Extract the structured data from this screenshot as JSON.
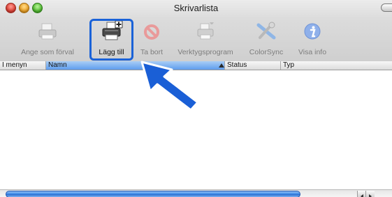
{
  "window": {
    "title": "Skrivarlista"
  },
  "toolbar": {
    "items": [
      {
        "label": "Ange som förval",
        "icon": "printer-default-icon",
        "enabled": false
      },
      {
        "label": "Lägg till",
        "icon": "printer-add-icon",
        "enabled": true
      },
      {
        "label": "Ta bort",
        "icon": "delete-icon",
        "enabled": false
      },
      {
        "label": "Verktygsprogram",
        "icon": "utility-icon",
        "enabled": false
      },
      {
        "label": "ColorSync",
        "icon": "colorsync-icon",
        "enabled": false
      },
      {
        "label": "Visa info",
        "icon": "info-icon",
        "enabled": false
      }
    ]
  },
  "table": {
    "columns": [
      "I menyn",
      "Namn",
      "Status",
      "Typ"
    ],
    "sorted_column": "Namn",
    "rows": []
  },
  "colors": {
    "highlight": "#1a62d8",
    "arrow": "#1a5fd6",
    "selected_header": "#7fb3f0"
  }
}
